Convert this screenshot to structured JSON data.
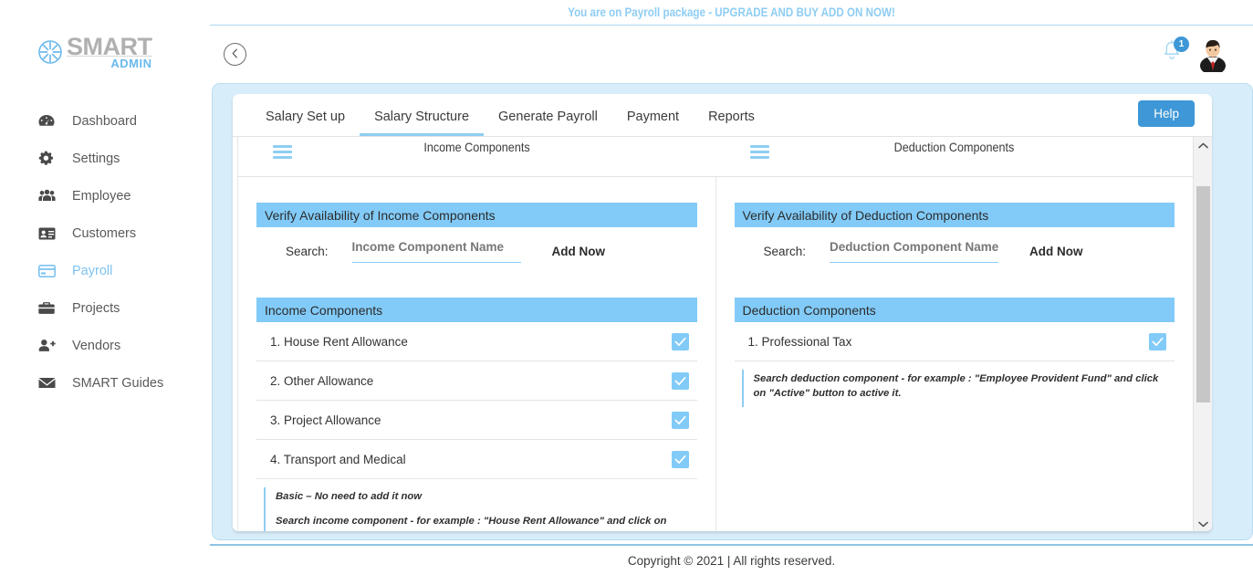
{
  "brand": {
    "name": "SMART",
    "sub": "ADMIN",
    "logo_icon": "asterisk-wheel-icon"
  },
  "sidebar": {
    "items": [
      {
        "label": "Dashboard",
        "icon": "dashboard-icon",
        "active": false
      },
      {
        "label": "Settings",
        "icon": "gear-icon",
        "active": false
      },
      {
        "label": "Employee",
        "icon": "users-icon",
        "active": false
      },
      {
        "label": "Customers",
        "icon": "id-card-icon",
        "active": false
      },
      {
        "label": "Payroll",
        "icon": "credit-card-icon",
        "active": true
      },
      {
        "label": "Projects",
        "icon": "briefcase-icon",
        "active": false
      },
      {
        "label": "Vendors",
        "icon": "user-plus-icon",
        "active": false
      },
      {
        "label": "SMART Guides",
        "icon": "envelope-icon",
        "active": false
      }
    ]
  },
  "banner": {
    "text": "You are on Payroll package - UPGRADE AND BUY ADD ON NOW!"
  },
  "header": {
    "back_icon": "chevron-left-circle-icon",
    "bell_icon": "bell-icon",
    "notification_count": "1",
    "avatar_icon": "user-avatar-icon"
  },
  "tabs": [
    {
      "label": "Salary Set up",
      "active": false
    },
    {
      "label": "Salary Structure",
      "active": true
    },
    {
      "label": "Generate Payroll",
      "active": false
    },
    {
      "label": "Payment",
      "active": false
    },
    {
      "label": "Reports",
      "active": false
    }
  ],
  "help_button": {
    "label": "Help"
  },
  "column_heads": [
    {
      "title": "Income Components",
      "icon": "hamburger-icon"
    },
    {
      "title": "Deduction Components",
      "icon": "hamburger-icon"
    }
  ],
  "income_panel": {
    "verify_title": "Verify Availability of Income Components",
    "search_label": "Search:",
    "search_value": "",
    "search_placeholder": "Income Component Name",
    "add_now_label": "Add Now",
    "list_title": "Income Components",
    "items": [
      {
        "label": "1. House Rent Allowance",
        "checked": true
      },
      {
        "label": "2. Other Allowance",
        "checked": true
      },
      {
        "label": "3. Project Allowance",
        "checked": true
      },
      {
        "label": "4. Transport and Medical",
        "checked": true
      }
    ],
    "notes": [
      "Basic – No need to add it now",
      "Search income component - for example : \"House Rent Allowance\" and click on \"Active\" button to active it. Please do not add Basic and this component is in built."
    ]
  },
  "deduction_panel": {
    "verify_title": "Verify Availability of Deduction Components",
    "search_label": "Search:",
    "search_value": "",
    "search_placeholder": "Deduction Component Name",
    "add_now_label": "Add Now",
    "list_title": "Deduction Components",
    "items": [
      {
        "label": "1. Professional Tax",
        "checked": true
      }
    ],
    "notes": [
      "Search deduction component - for example : \"Employee Provident Fund\" and click on \"Active\" button to active it."
    ]
  },
  "scrollbar": {
    "up_icon": "chevron-up-icon",
    "down_icon": "chevron-down-icon"
  },
  "footer": {
    "text": "Copyright © 2021 | All rights reserved."
  },
  "colors": {
    "accent_blue": "#82cbf8",
    "button_blue": "#3e97d6",
    "panel_bg": "#d8edfa",
    "banner_text": "#8ecdf3"
  }
}
